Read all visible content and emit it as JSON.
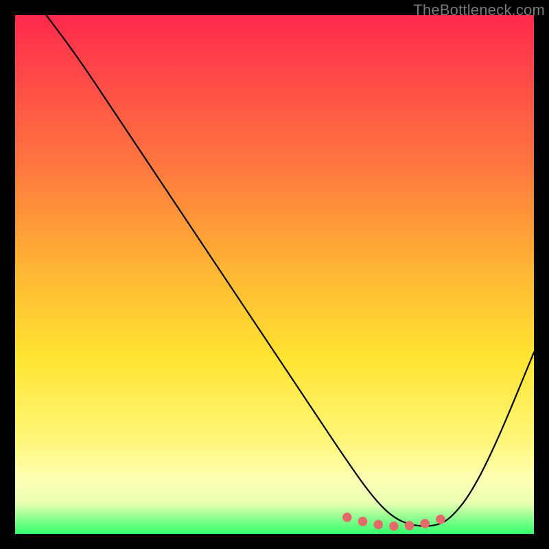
{
  "watermark": "TheBottleneck.com",
  "chart_data": {
    "type": "line",
    "title": "",
    "xlabel": "",
    "ylabel": "",
    "xlim": [
      0,
      100
    ],
    "ylim": [
      0,
      100
    ],
    "grid": false,
    "series": [
      {
        "name": "bottleneck-curve",
        "color": "#000000",
        "x": [
          6,
          12,
          20,
          30,
          40,
          50,
          58,
          64,
          69,
          73,
          77,
          81,
          84,
          88,
          93,
          100
        ],
        "y": [
          100,
          92,
          80,
          65,
          50,
          35,
          23,
          14,
          7,
          3,
          1.5,
          1.5,
          3,
          8,
          18,
          35
        ]
      },
      {
        "name": "optimal-range-markers",
        "color": "#e46a6a",
        "type": "scatter",
        "x": [
          64,
          67,
          70,
          73,
          76,
          79,
          82
        ],
        "y": [
          3.2,
          2.4,
          1.8,
          1.5,
          1.6,
          2.0,
          2.8
        ]
      }
    ],
    "background_gradient": {
      "orientation": "vertical",
      "stops": [
        {
          "pos": 0.0,
          "color": "#ff2a4d"
        },
        {
          "pos": 0.3,
          "color": "#ff7a3e"
        },
        {
          "pos": 0.66,
          "color": "#ffe431"
        },
        {
          "pos": 0.92,
          "color": "#fcffb4"
        },
        {
          "pos": 1.0,
          "color": "#31ff6b"
        }
      ]
    }
  }
}
